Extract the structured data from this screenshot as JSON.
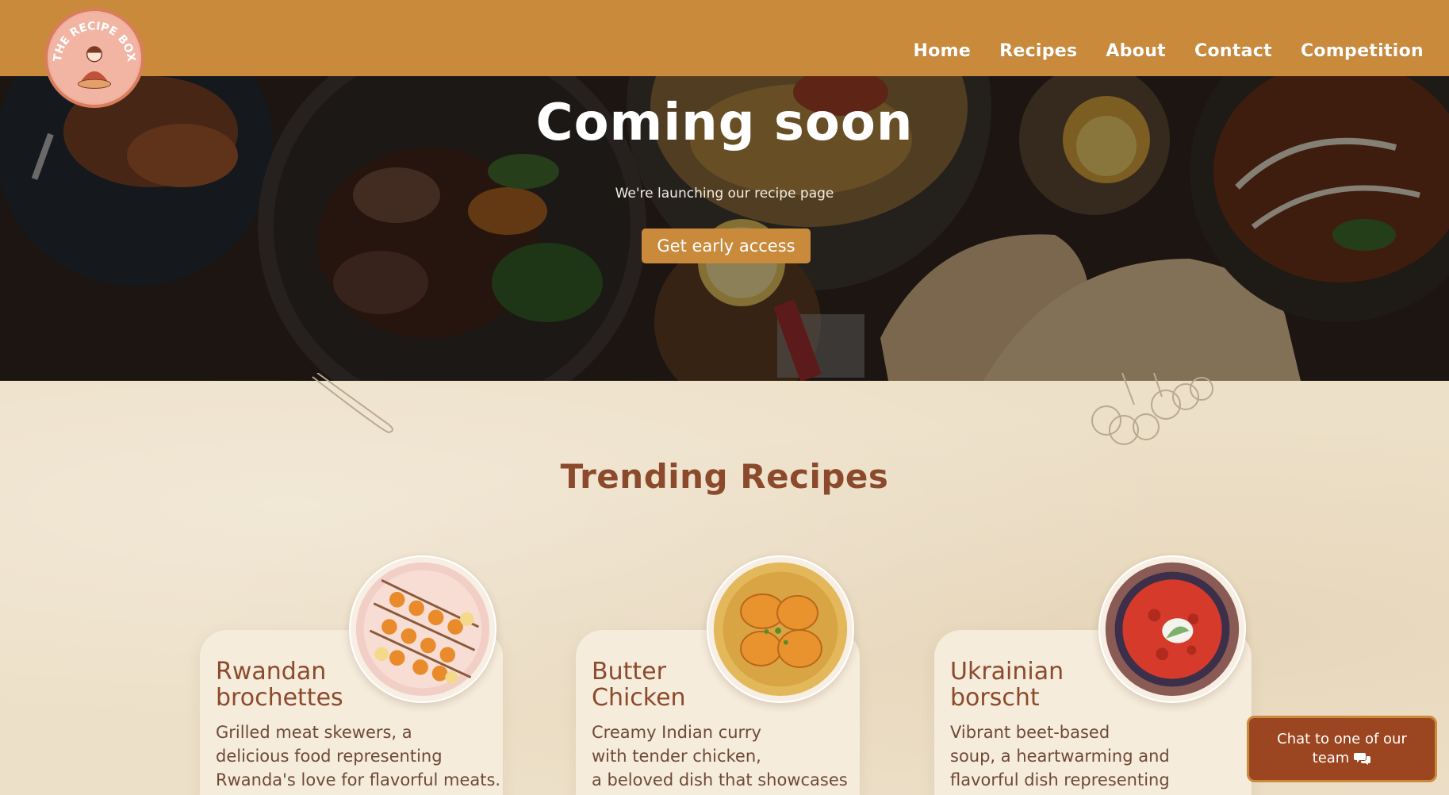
{
  "brand": {
    "logo_text": "THE RECIPE BOX",
    "colors": {
      "header": "#c98a3b",
      "accent": "#8c4a2c",
      "chat": "#9b4620",
      "paper": "#ede0c8"
    }
  },
  "nav": {
    "items": [
      {
        "label": "Home"
      },
      {
        "label": "Recipes"
      },
      {
        "label": "About"
      },
      {
        "label": "Contact"
      },
      {
        "label": "Competition"
      }
    ]
  },
  "hero": {
    "title": "Coming soon",
    "subtitle": "We're launching our recipe page",
    "cta_label": "Get early access"
  },
  "trending": {
    "title": "Trending Recipes",
    "cards": [
      {
        "title_line1": "Rwandan",
        "title_line2": "brochettes",
        "desc_line1": "Grilled meat skewers, a",
        "desc_line2": "delicious food representing",
        "desc_line3": "Rwanda's love for flavorful meats.",
        "image_icon": "skewers-plate-icon"
      },
      {
        "title_line1": "Butter",
        "title_line2": "Chicken",
        "desc_line1": "Creamy Indian curry",
        "desc_line2": "with tender chicken,",
        "desc_line3": "a beloved dish that showcases",
        "image_icon": "butter-chicken-plate-icon"
      },
      {
        "title_line1": "Ukrainian",
        "title_line2": "borscht",
        "desc_line1": "Vibrant beet-based",
        "desc_line2": "soup, a heartwarming and",
        "desc_line3": "flavorful dish representing",
        "image_icon": "borscht-bowl-icon"
      }
    ]
  },
  "chat": {
    "line1": "Chat to one of our",
    "line2": "team",
    "icon": "chat-bubbles-icon"
  }
}
